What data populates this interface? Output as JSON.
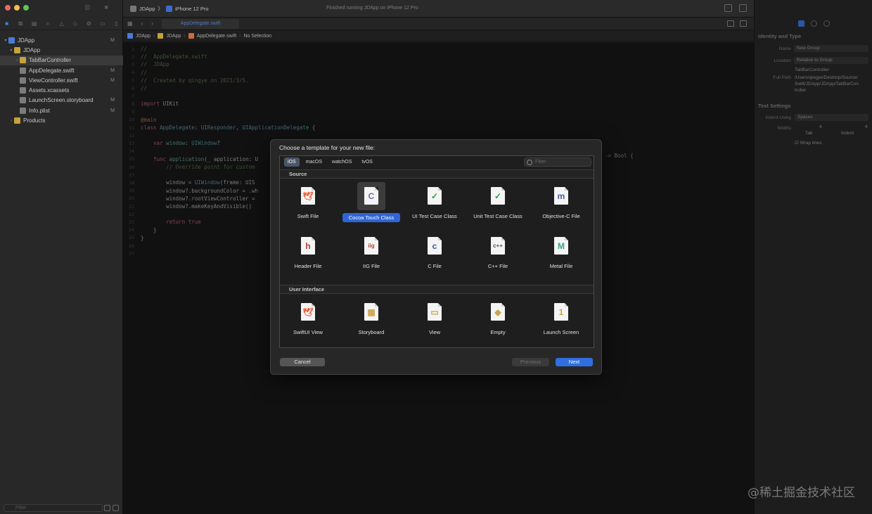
{
  "toolbar": {
    "scheme_project": "JDApp",
    "scheme_device": "iPhone 12 Pro",
    "activity_status": "Finished running JDApp on iPhone 12 Pro"
  },
  "navigator": {
    "filter_placeholder": "Filter",
    "tree": [
      {
        "label": "JDApp",
        "badge": "M",
        "kind": "proj",
        "indent": 0,
        "disc": "▾"
      },
      {
        "label": "JDApp",
        "badge": "",
        "kind": "folder",
        "indent": 1,
        "disc": "▾"
      },
      {
        "label": "TabBarController",
        "badge": "",
        "kind": "folder",
        "indent": 2,
        "disc": "›",
        "selected": true
      },
      {
        "label": "AppDelegate.swift",
        "badge": "M",
        "kind": "file",
        "indent": 2,
        "disc": ""
      },
      {
        "label": "ViewController.swift",
        "badge": "M",
        "kind": "file",
        "indent": 2,
        "disc": ""
      },
      {
        "label": "Assets.xcassets",
        "badge": "",
        "kind": "file",
        "indent": 2,
        "disc": ""
      },
      {
        "label": "LaunchScreen.storyboard",
        "badge": "M",
        "kind": "file",
        "indent": 2,
        "disc": ""
      },
      {
        "label": "Info.plist",
        "badge": "M",
        "kind": "file",
        "indent": 2,
        "disc": ""
      },
      {
        "label": "Products",
        "badge": "",
        "kind": "folder",
        "indent": 1,
        "disc": "›"
      }
    ]
  },
  "editor": {
    "tab_title": "AppDelegate.swift",
    "jumpbar": [
      "JDApp",
      "JDApp",
      "AppDelegate.swift",
      "No Selection"
    ],
    "code_lines": [
      {
        "n": "1",
        "html": "<span class='c-comment'>//</span>"
      },
      {
        "n": "2",
        "html": "<span class='c-comment'>//  AppDelegate.swift</span>"
      },
      {
        "n": "3",
        "html": "<span class='c-comment'>//  JDApp</span>"
      },
      {
        "n": "4",
        "html": "<span class='c-comment'>//</span>"
      },
      {
        "n": "5",
        "html": "<span class='c-comment'>//  Created by qingye on 2021/3/5.</span>"
      },
      {
        "n": "6",
        "html": "<span class='c-comment'>//</span>"
      },
      {
        "n": "7",
        "html": ""
      },
      {
        "n": "8",
        "html": "<span class='c-kw'>import</span> UIKit"
      },
      {
        "n": "9",
        "html": ""
      },
      {
        "n": "10",
        "html": "<span class='c-attr'>@main</span>"
      },
      {
        "n": "11",
        "html": "<span class='c-kw'>class</span> <span class='c-type'>AppDelegate</span>: <span class='c-type'>UIResponder</span>, <span class='c-type'>UIApplicationDelegate</span> {"
      },
      {
        "n": "12",
        "html": ""
      },
      {
        "n": "13",
        "html": "    <span class='c-kw'>var</span> <span class='c-prop'>window</span>: <span class='c-type'>UIWindow</span>?"
      },
      {
        "n": "14",
        "html": ""
      },
      {
        "n": "15",
        "html": "    <span class='c-kw'>func</span> <span class='c-prop'>application</span>(_ application: U"
      },
      {
        "n": "16",
        "html": "        <span class='c-comment'>// Override point for custom</span>"
      },
      {
        "n": "17",
        "html": ""
      },
      {
        "n": "18",
        "html": "        window = <span class='c-type'>UIWindow</span>(frame: UIS"
      },
      {
        "n": "19",
        "html": "        window?.backgroundColor = .wh"
      },
      {
        "n": "20",
        "html": "        window?.rootViewController = "
      },
      {
        "n": "21",
        "html": "        window?.makeKeyAndVisible()"
      },
      {
        "n": "22",
        "html": ""
      },
      {
        "n": "23",
        "html": "        <span class='c-kw'>return</span> <span class='c-kw'>true</span>"
      },
      {
        "n": "24",
        "html": "    }"
      },
      {
        "n": "25",
        "html": "}"
      },
      {
        "n": "26",
        "html": ""
      },
      {
        "n": "27",
        "html": ""
      }
    ],
    "ghost_text": "-> Bool {"
  },
  "inspector": {
    "identity_title": "Identity and Type",
    "name_label": "Name",
    "name_value": "New Group",
    "location_label": "Location",
    "location_value": "Relative to Group",
    "location_folder": "TabBarController",
    "fullpath_label": "Full Path",
    "fullpath_value": "/Users/qingye/Desktop/Source/Swift/JDApp/JDApp/TabBarController",
    "text_settings_title": "Text Settings",
    "indent_using_label": "Indent Using",
    "indent_using_value": "Spaces",
    "widths_label": "Widths",
    "tab_value": "4",
    "indent_value": "4",
    "tab_label": "Tab",
    "indent_label": "Indent",
    "wrap_lines_label": "Wrap lines"
  },
  "dialog": {
    "title": "Choose a template for your new file:",
    "platforms": [
      "iOS",
      "macOS",
      "watchOS",
      "tvOS"
    ],
    "filter_placeholder": "Filter",
    "section_source": "Source",
    "section_ui": "User Interface",
    "source_templates": [
      {
        "name": "Swift File",
        "glyph": "🕊",
        "color": "#e8613a"
      },
      {
        "name": "Cocoa Touch Class",
        "glyph": "C",
        "color": "#6f6ab8",
        "selected": true
      },
      {
        "name": "UI Test Case Class",
        "glyph": "✓",
        "color": "#2e9e3e"
      },
      {
        "name": "Unit Test Case Class",
        "glyph": "✓",
        "color": "#2e9e3e"
      },
      {
        "name": "Objective-C File",
        "glyph": "m",
        "color": "#4a5c9c"
      },
      {
        "name": "Header File",
        "glyph": "h",
        "color": "#b04232"
      },
      {
        "name": "IIG File",
        "glyph": "iig",
        "color": "#b04232"
      },
      {
        "name": "C File",
        "glyph": "c",
        "color": "#3b59a8"
      },
      {
        "name": "C++ File",
        "glyph": "c++",
        "color": "#555555"
      },
      {
        "name": "Metal File",
        "glyph": "M",
        "color": "#3d9f8c"
      }
    ],
    "ui_templates": [
      {
        "name": "SwiftUI View",
        "glyph": "🕊",
        "color": "#e8613a"
      },
      {
        "name": "Storyboard",
        "glyph": "▦",
        "color": "#c9a54a"
      },
      {
        "name": "View",
        "glyph": "▭",
        "color": "#c9a54a"
      },
      {
        "name": "Empty",
        "glyph": "◆",
        "color": "#c9a54a"
      },
      {
        "name": "Launch Screen",
        "glyph": "1",
        "color": "#c9a54a"
      }
    ],
    "cancel_label": "Cancel",
    "previous_label": "Previous",
    "next_label": "Next"
  },
  "watermark": "@稀土掘金技术社区"
}
